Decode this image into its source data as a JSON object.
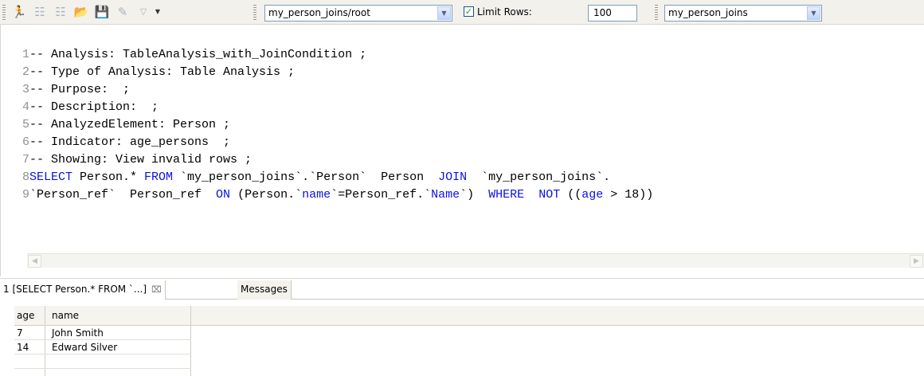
{
  "toolbar": {
    "icons": [
      "run-icon",
      "run-step-icon",
      "run-all-icon",
      "open-folder-icon",
      "save-icon",
      "erase-icon",
      "dropdown-icon"
    ],
    "connection_combo": "my_person_joins/root",
    "limit_rows_label": "Limit Rows:",
    "limit_rows_checked": true,
    "limit_rows_value": "100",
    "schema_combo": "my_person_joins"
  },
  "editor": {
    "lines": [
      {
        "n": "1",
        "text": "-- Analysis: TableAnalysis_with_JoinCondition ;"
      },
      {
        "n": "2",
        "text": "-- Type of Analysis: Table Analysis ;"
      },
      {
        "n": "3",
        "text": "-- Purpose:  ;"
      },
      {
        "n": "4",
        "text": "-- Description:  ;"
      },
      {
        "n": "5",
        "text": "-- AnalyzedElement: Person ;"
      },
      {
        "n": "6",
        "text": "-- Indicator: age_persons  ;"
      },
      {
        "n": "7",
        "text": "-- Showing: View invalid rows ;"
      }
    ],
    "line8": {
      "n": "8",
      "kw_select": "SELECT",
      "t1": " Person.* ",
      "kw_from": "FROM",
      "t2": " `my_person_joins`.`Person`  Person  ",
      "kw_join": "JOIN",
      "t3": "  `my_person_joins`."
    },
    "line9": {
      "n": "9",
      "t1": "`Person_ref`  Person_ref  ",
      "kw_on": "ON",
      "t2": " (Person.`",
      "kw_name1": "name",
      "t3": "`=Person_ref.`",
      "kw_name2": "Name",
      "t4": "`)  ",
      "kw_where": "WHERE",
      "t5": "  ",
      "kw_not": "NOT",
      "t6": " ((",
      "kw_age": "age",
      "t7": " > 18))"
    }
  },
  "results": {
    "tabs": [
      {
        "label": "1 [SELECT Person.* FROM `...]"
      },
      {
        "label": "Messages"
      }
    ],
    "columns": [
      "age",
      "name"
    ],
    "rows": [
      {
        "age": "7",
        "name": "John Smith"
      },
      {
        "age": "14",
        "name": "Edward Silver"
      }
    ]
  }
}
